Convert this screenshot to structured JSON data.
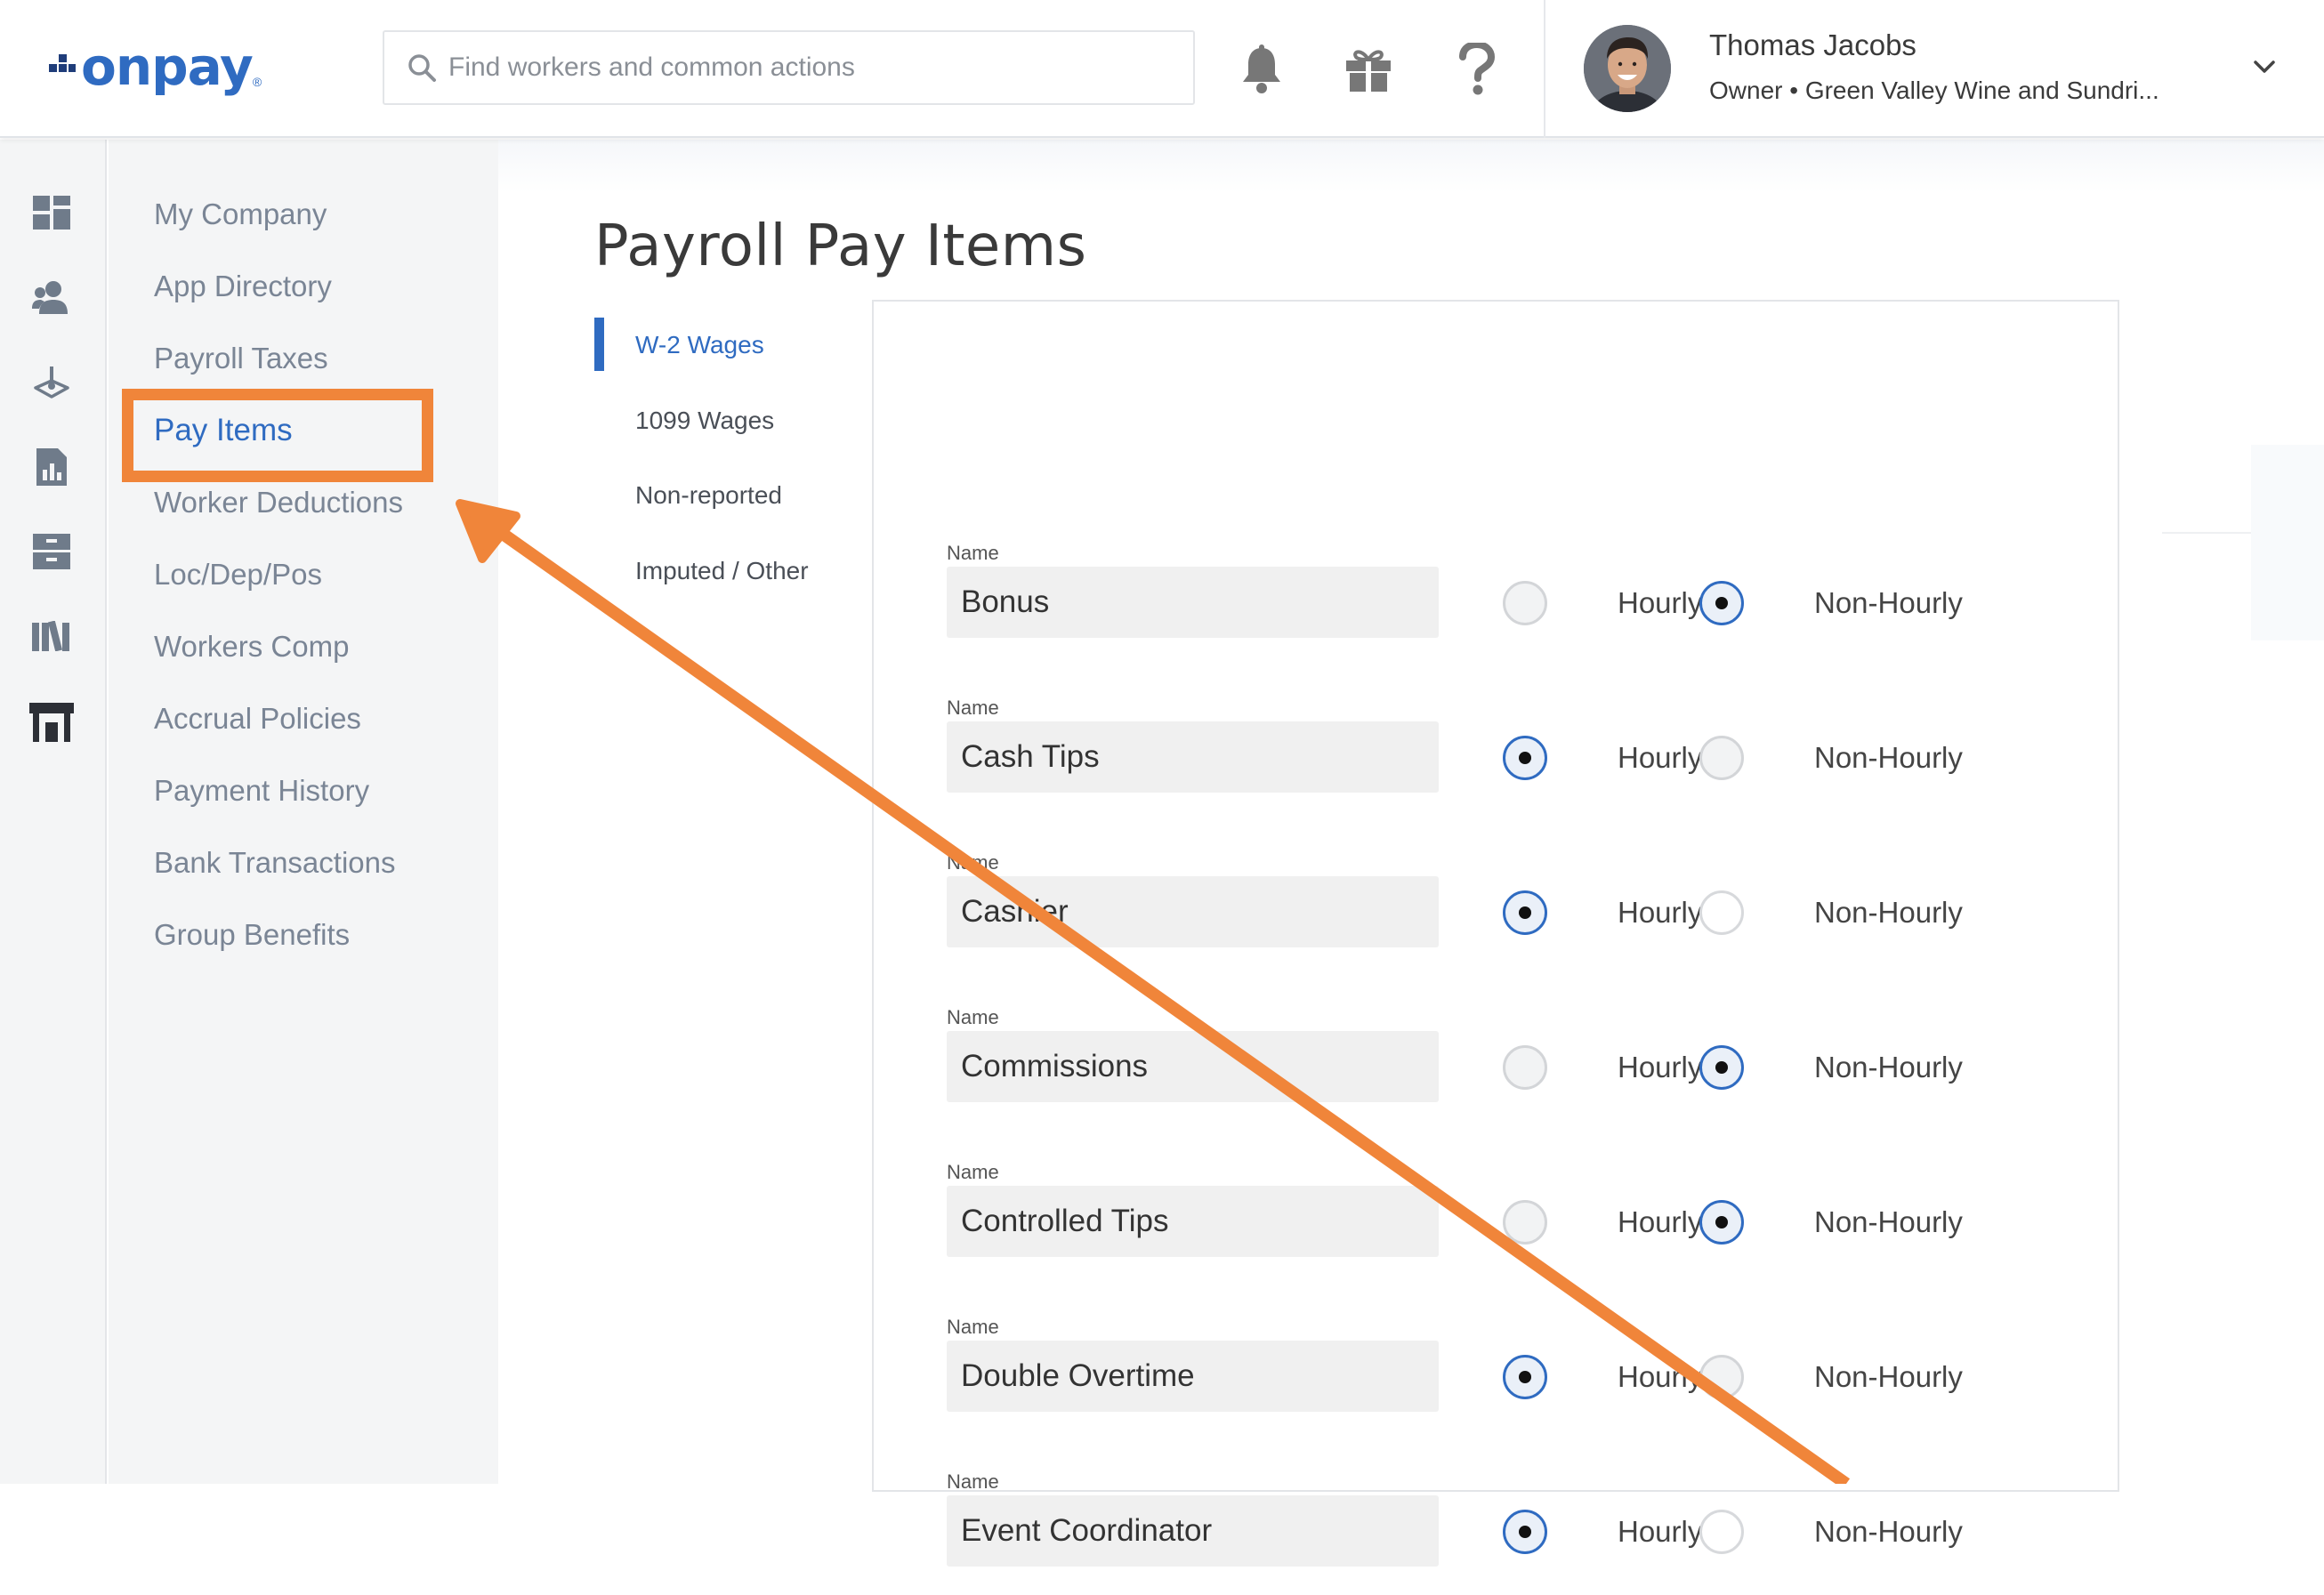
{
  "header": {
    "logo_text": "onpay",
    "logo_reg": "®",
    "search_placeholder": "Find workers and common actions",
    "icons": [
      "bell-icon",
      "gift-icon",
      "help-icon"
    ],
    "user": {
      "name": "Thomas Jacobs",
      "role": "Owner • Green Valley Wine and Sundri..."
    }
  },
  "rail": {
    "icons": [
      "dashboard-icon",
      "people-icon",
      "timesheet-icon",
      "reports-icon",
      "documents-icon",
      "library-icon",
      "store-icon"
    ]
  },
  "subnav": {
    "items": [
      {
        "label": "My Company"
      },
      {
        "label": "App Directory"
      },
      {
        "label": "Payroll Taxes"
      },
      {
        "label": "Pay Items",
        "active": true
      },
      {
        "label": "Worker Deductions"
      },
      {
        "label": "Loc/Dep/Pos"
      },
      {
        "label": "Workers Comp"
      },
      {
        "label": "Accrual Policies"
      },
      {
        "label": "Payment History"
      },
      {
        "label": "Bank Transactions"
      },
      {
        "label": "Group Benefits"
      }
    ]
  },
  "main": {
    "title": "Payroll Pay Items",
    "tabs": [
      {
        "label": "W-2 Wages",
        "active": true
      },
      {
        "label": "1099 Wages"
      },
      {
        "label": "Non-reported"
      },
      {
        "label": "Imputed / Other"
      }
    ],
    "field_label": "Name",
    "option_hourly": "Hourly",
    "option_non_hourly": "Non-Hourly",
    "pay_items": [
      {
        "name": "Bonus",
        "selected": "non-hourly"
      },
      {
        "name": "Cash Tips",
        "selected": "hourly"
      },
      {
        "name": "Cashier",
        "selected": "hourly"
      },
      {
        "name": "Commissions",
        "selected": "non-hourly"
      },
      {
        "name": "Controlled Tips",
        "selected": "non-hourly"
      },
      {
        "name": "Double Overtime",
        "selected": "hourly"
      },
      {
        "name": "Event Coordinator",
        "selected": "hourly"
      }
    ]
  },
  "annotation": {
    "highlight_color": "#f0853a",
    "arrow_color": "#f0853a"
  },
  "colors": {
    "brand_blue": "#2f6bc1",
    "nav_text": "#7a8595",
    "field_bg": "#f0f0f0"
  }
}
